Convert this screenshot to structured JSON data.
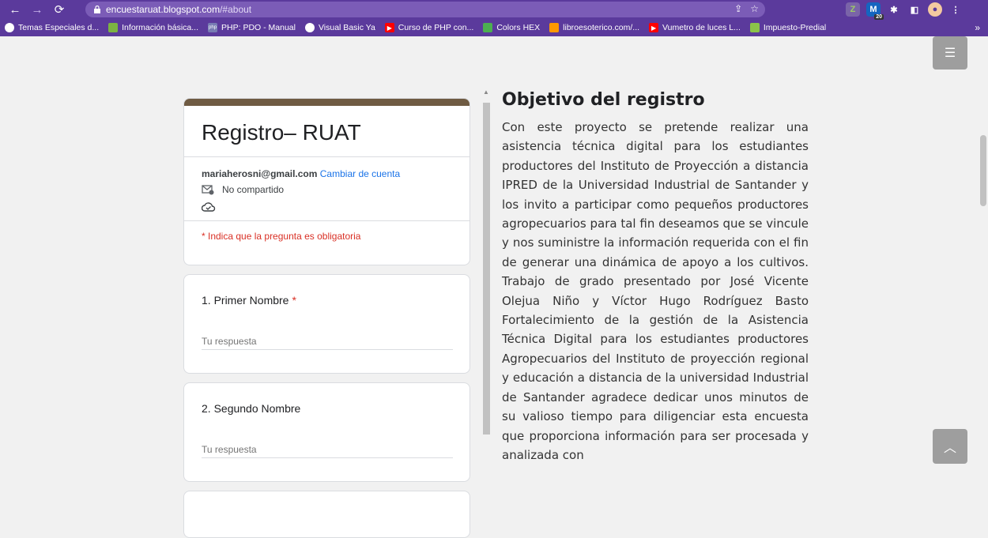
{
  "browser": {
    "url_host": "encuestaruat.blogspot.com",
    "url_path": "/#about",
    "extension_badge": "20",
    "bookmarks": [
      {
        "label": "Temas Especiales d...",
        "color": "#ffffff"
      },
      {
        "label": "Información básica...",
        "color": "#7cb342"
      },
      {
        "label": "PHP: PDO - Manual",
        "color": "#777bb3"
      },
      {
        "label": "Visual Basic Ya",
        "color": "#ffffff"
      },
      {
        "label": "Curso de PHP con...",
        "color": "#ff0000"
      },
      {
        "label": "Colors HEX",
        "color": "#4caf50"
      },
      {
        "label": "libroesoterico.com/...",
        "color": "#ff9800"
      },
      {
        "label": "Vumetro de luces L...",
        "color": "#ff0000"
      },
      {
        "label": "Impuesto-Predial",
        "color": "#8bc34a"
      }
    ],
    "more": "»"
  },
  "form": {
    "title": "Registro– RUAT",
    "email": "mariaherosni@gmail.com",
    "switch_account": "Cambiar de cuenta",
    "not_shared": "No compartido",
    "required_note": "* Indica que la pregunta es obligatoria",
    "questions": [
      {
        "label": "1. Primer Nombre",
        "required": "*",
        "placeholder": "Tu respuesta"
      },
      {
        "label": "2. Segundo Nombre",
        "placeholder": "Tu respuesta"
      }
    ]
  },
  "article": {
    "heading": "Objetivo del registro",
    "body": "Con este proyecto se pretende realizar una asistencia técnica digital para los estudiantes productores del Instituto de Proyección a distancia IPRED de la Universidad Industrial de Santander y los invito a participar como pequeños productores agropecuarios para tal fin deseamos que se vincule y nos suministre la información requerida con el fin de generar una dinámica de apoyo a los cultivos. Trabajo de grado presentado por José Vicente Olejua Niño y Víctor Hugo Rodríguez Basto Fortalecimiento de la gestión de la Asistencia Técnica Digital para los estudiantes productores Agropecuarios del Instituto de proyección regional y educación a distancia de la universidad Industrial de Santander agradece dedicar unos minutos de su valioso tiempo para diligenciar esta encuesta que proporciona información para ser procesada y analizada con"
  },
  "colors": {
    "chrome": "#5b3a9c",
    "header_bar": "#6f5b43",
    "link": "#1a73e8",
    "required": "#d93025"
  }
}
